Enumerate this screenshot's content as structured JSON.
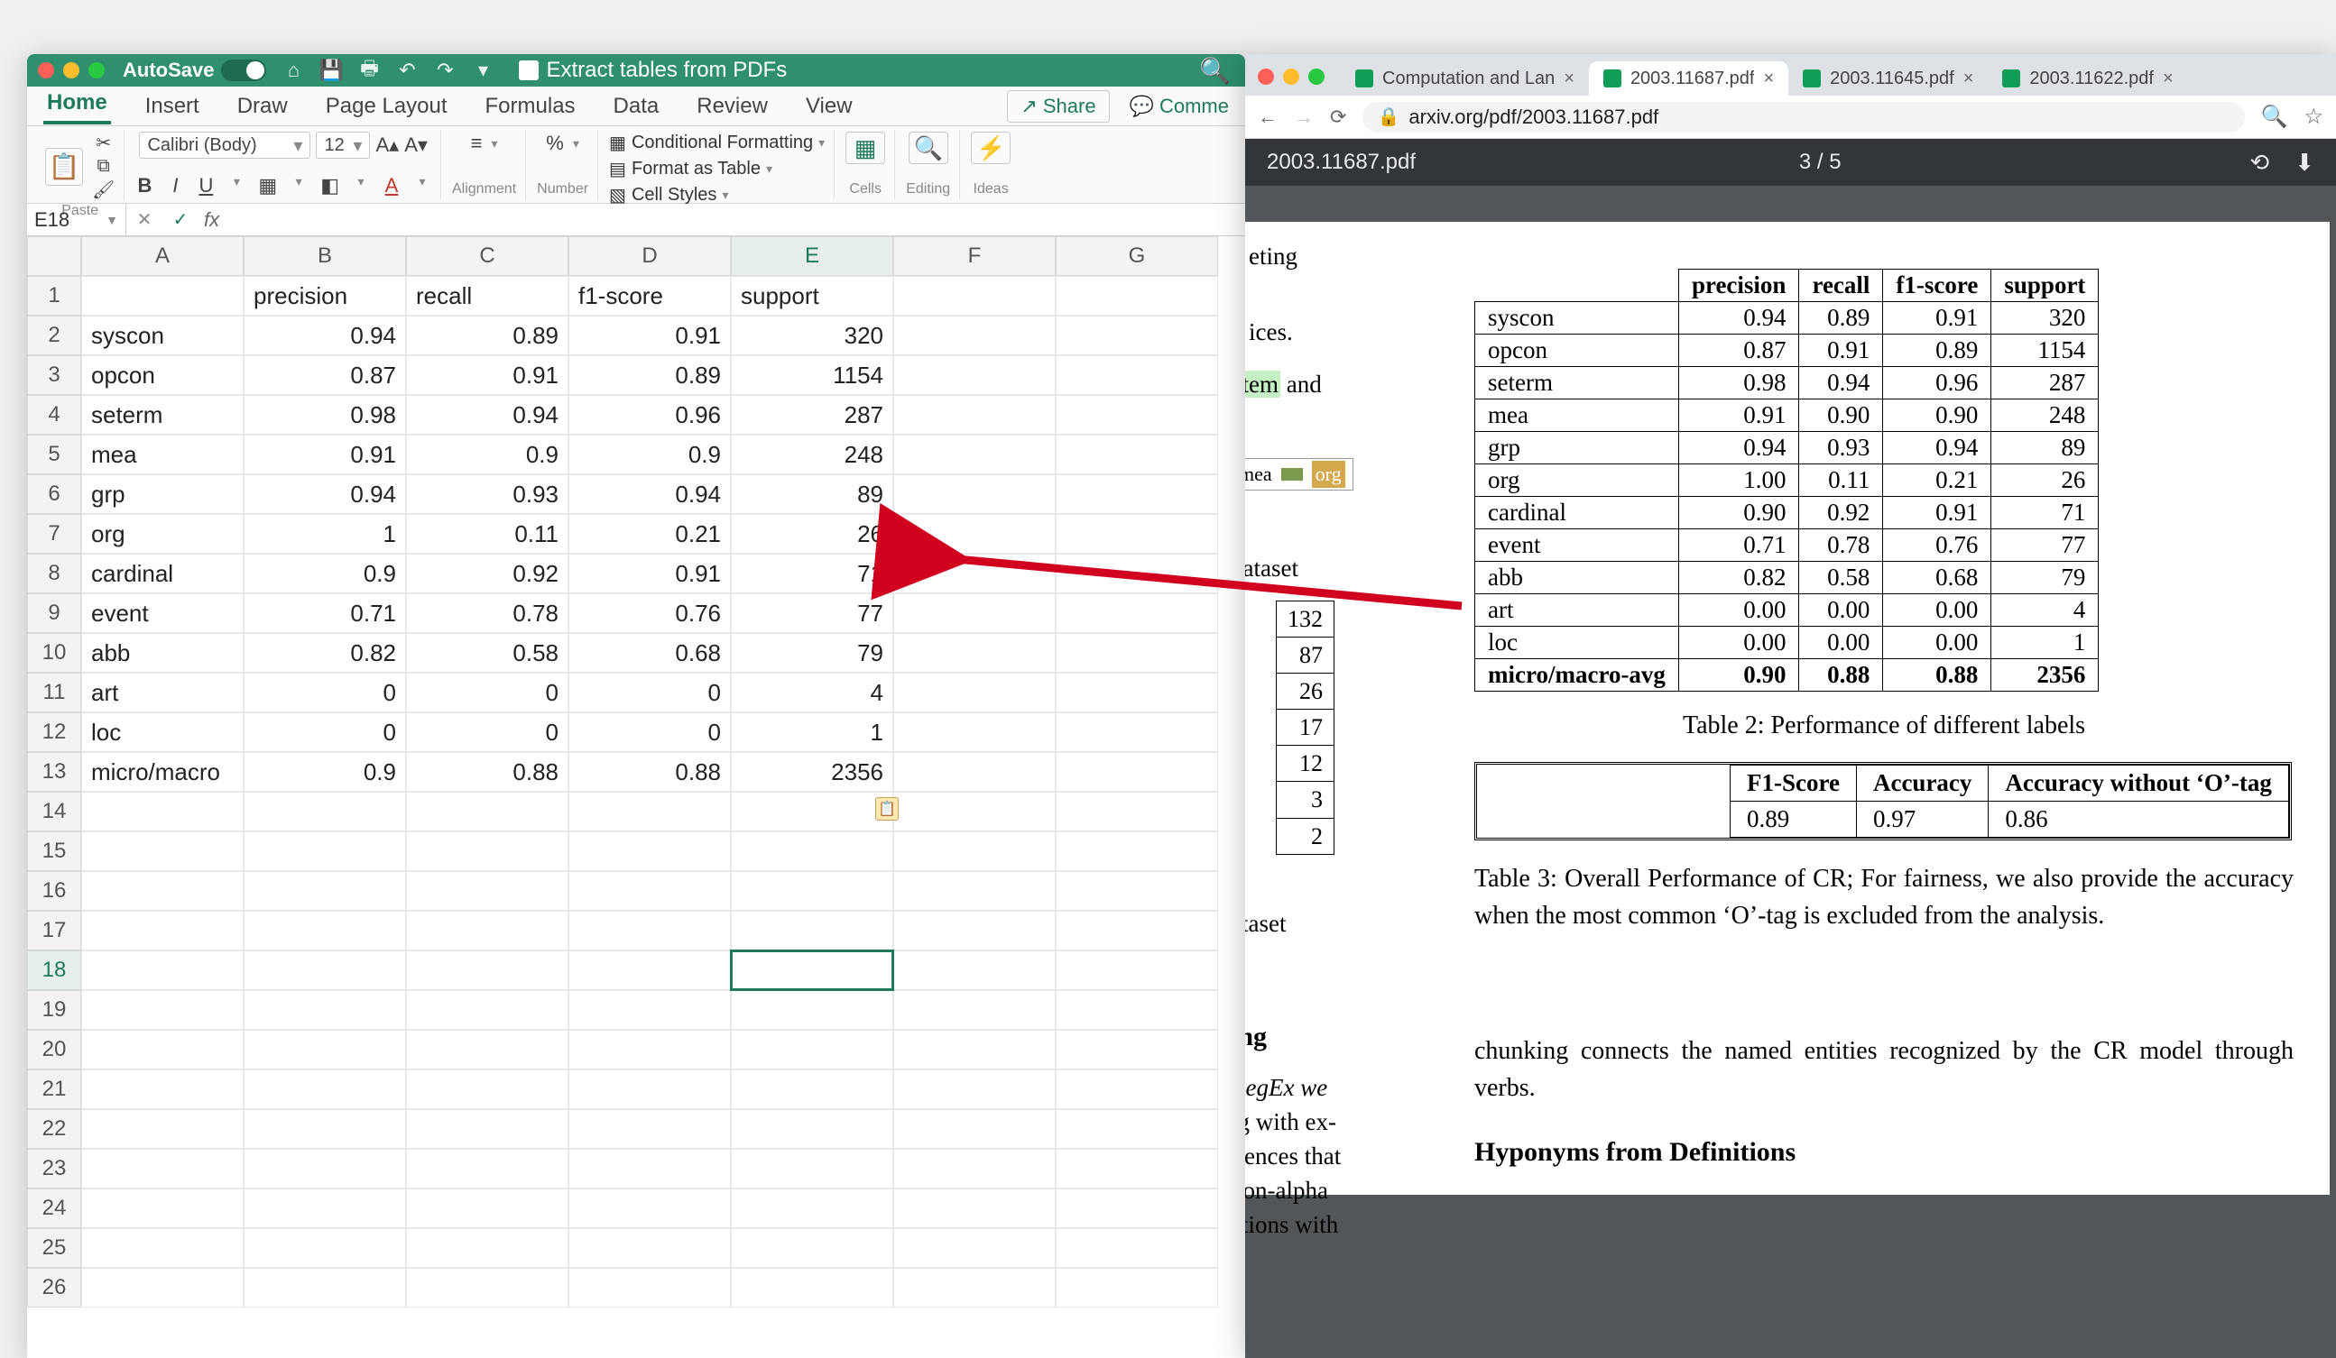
{
  "excel": {
    "autosave_label": "AutoSave",
    "filename": "Extract tables from PDFs",
    "menu": [
      "Home",
      "Insert",
      "Draw",
      "Page Layout",
      "Formulas",
      "Data",
      "Review",
      "View"
    ],
    "active_menu": "Home",
    "share_label": "Share",
    "comments_label": "Comme",
    "paste_label": "Paste",
    "font_name": "Calibri (Body)",
    "font_size": "12",
    "group_alignment": "Alignment",
    "group_number": "Number",
    "cond_formatting": "Conditional Formatting",
    "format_table": "Format as Table",
    "cell_styles": "Cell Styles",
    "cells_label": "Cells",
    "editing_label": "Editing",
    "ideas_label": "Ideas",
    "namebox": "E18",
    "cols": [
      "A",
      "B",
      "C",
      "D",
      "E",
      "F",
      "G"
    ],
    "row_count": 26,
    "headers": [
      "",
      "precision",
      "recall",
      "f1-score",
      "support"
    ],
    "rows": [
      [
        "syscon",
        "0.94",
        "0.89",
        "0.91",
        "320"
      ],
      [
        "opcon",
        "0.87",
        "0.91",
        "0.89",
        "1154"
      ],
      [
        "seterm",
        "0.98",
        "0.94",
        "0.96",
        "287"
      ],
      [
        "mea",
        "0.91",
        "0.9",
        "0.9",
        "248"
      ],
      [
        "grp",
        "0.94",
        "0.93",
        "0.94",
        "89"
      ],
      [
        "org",
        "1",
        "0.11",
        "0.21",
        "26"
      ],
      [
        "cardinal",
        "0.9",
        "0.92",
        "0.91",
        "71"
      ],
      [
        "event",
        "0.71",
        "0.78",
        "0.76",
        "77"
      ],
      [
        "abb",
        "0.82",
        "0.58",
        "0.68",
        "79"
      ],
      [
        "art",
        "0",
        "0",
        "0",
        "4"
      ],
      [
        "loc",
        "0",
        "0",
        "0",
        "1"
      ],
      [
        "micro/macro",
        "0.9",
        "0.88",
        "0.88",
        "2356"
      ]
    ],
    "selected_cell": "E18"
  },
  "chrome": {
    "tabs": [
      {
        "title": "Computation and Lan",
        "active": false
      },
      {
        "title": "2003.11687.pdf",
        "active": true
      },
      {
        "title": "2003.11645.pdf",
        "active": false
      },
      {
        "title": "2003.11622.pdf",
        "active": false
      }
    ],
    "url": "arxiv.org/pdf/2003.11687.pdf",
    "pdf_name": "2003.11687.pdf",
    "page_indicator": "3 / 5"
  },
  "pdf": {
    "left_fragments": {
      "f1": "eting",
      "f2": "ices.",
      "f3_a": "stem",
      "f3_b": " and",
      "legend_mea": "mea",
      "legend_org": "org",
      "dataset1": "dataset",
      "mini_values": [
        "132",
        "87",
        "26",
        "17",
        "12",
        "3",
        "2"
      ],
      "dataset2": "ataset",
      "hdr": "ing",
      "p_l1": "RegEx we",
      "p_l2": "ig with ex-",
      "p_l3": "itences that",
      "p_l4": "non-alpha",
      "p_l5": "ations with"
    },
    "table2_headers": [
      "",
      "precision",
      "recall",
      "f1-score",
      "support"
    ],
    "table2_rows": [
      [
        "syscon",
        "0.94",
        "0.89",
        "0.91",
        "320"
      ],
      [
        "opcon",
        "0.87",
        "0.91",
        "0.89",
        "1154"
      ],
      [
        "seterm",
        "0.98",
        "0.94",
        "0.96",
        "287"
      ],
      [
        "mea",
        "0.91",
        "0.90",
        "0.90",
        "248"
      ],
      [
        "grp",
        "0.94",
        "0.93",
        "0.94",
        "89"
      ],
      [
        "org",
        "1.00",
        "0.11",
        "0.21",
        "26"
      ],
      [
        "cardinal",
        "0.90",
        "0.92",
        "0.91",
        "71"
      ],
      [
        "event",
        "0.71",
        "0.78",
        "0.76",
        "77"
      ],
      [
        "abb",
        "0.82",
        "0.58",
        "0.68",
        "79"
      ],
      [
        "art",
        "0.00",
        "0.00",
        "0.00",
        "4"
      ],
      [
        "loc",
        "0.00",
        "0.00",
        "0.00",
        "1"
      ],
      [
        "micro/macro-avg",
        "0.90",
        "0.88",
        "0.88",
        "2356"
      ]
    ],
    "caption2": "Table 2: Performance of different labels",
    "table3_headers": [
      "F1-Score",
      "Accuracy",
      "Accuracy without ‘O’-tag"
    ],
    "table3_row": [
      "0.89",
      "0.97",
      "0.86"
    ],
    "caption3": "Table 3: Overall Performance of CR; For fairness, we also provide the accuracy when the most common ‘O’-tag is excluded from the analysis.",
    "body1": "chunking connects the named entities recognized by the CR model through verbs.",
    "section": "Hyponyms from Definitions"
  }
}
